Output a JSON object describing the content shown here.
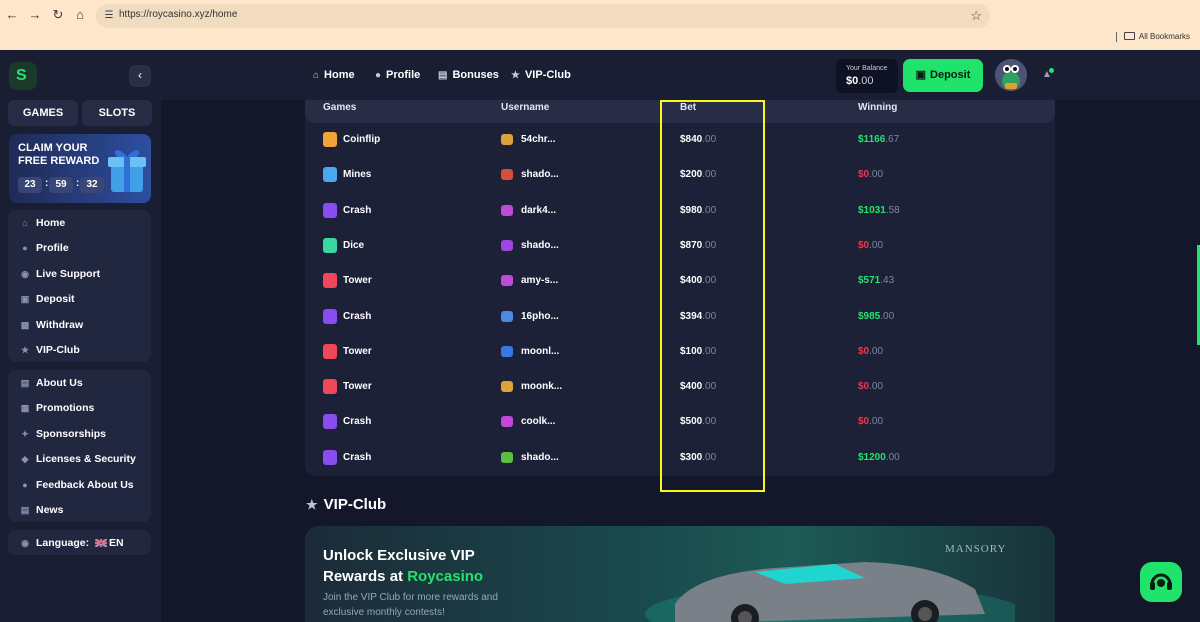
{
  "browser": {
    "url": "https://roycasino.xyz/home",
    "bookmarks_label": "All Bookmarks"
  },
  "sidebar": {
    "tabs": [
      "GAMES",
      "SLOTS"
    ],
    "promo": {
      "title": "CLAIM YOUR FREE REWARD",
      "countdown": [
        "23",
        "59",
        "32"
      ]
    },
    "main_menu": [
      {
        "label": "Home",
        "icon": "home-icon"
      },
      {
        "label": "Profile",
        "icon": "user-icon"
      },
      {
        "label": "Live Support",
        "icon": "headset-icon"
      },
      {
        "label": "Deposit",
        "icon": "wallet-icon"
      },
      {
        "label": "Withdraw",
        "icon": "withdraw-icon"
      },
      {
        "label": "VIP-Club",
        "icon": "star-icon"
      }
    ],
    "info_menu": [
      {
        "label": "About Us",
        "icon": "book-icon"
      },
      {
        "label": "Promotions",
        "icon": "promo-icon"
      },
      {
        "label": "Sponsorships",
        "icon": "sponsor-icon"
      },
      {
        "label": "Licenses & Security",
        "icon": "shield-icon"
      },
      {
        "label": "Feedback About Us",
        "icon": "feedback-icon"
      },
      {
        "label": "News",
        "icon": "news-icon"
      }
    ],
    "language": {
      "label": "Language:",
      "value": "EN"
    }
  },
  "topbar": {
    "nav": [
      "Home",
      "Profile",
      "Bonuses",
      "VIP-Club"
    ],
    "balance_label": "Your Balance",
    "balance_whole": "$0",
    "balance_cents": ".00",
    "deposit_label": "Deposit"
  },
  "table": {
    "headers": [
      "Games",
      "Username",
      "Bet",
      "Winning"
    ],
    "rows": [
      {
        "game": "Coinflip",
        "game_color": "#f2a43a",
        "user": "54chr...",
        "user_color": "#e0a03a",
        "bet": "$840",
        "bet_c": ".00",
        "win": "$1166",
        "win_c": ".67",
        "status": "win"
      },
      {
        "game": "Mines",
        "game_color": "#4aa8f0",
        "user": "shado...",
        "user_color": "#d5503a",
        "bet": "$200",
        "bet_c": ".00",
        "win": "$0",
        "win_c": ".00",
        "status": "loss"
      },
      {
        "game": "Crash",
        "game_color": "#8a4cf0",
        "user": "dark4...",
        "user_color": "#c04ad8",
        "bet": "$980",
        "bet_c": ".00",
        "win": "$1031",
        "win_c": ".58",
        "status": "win"
      },
      {
        "game": "Dice",
        "game_color": "#3ad8a0",
        "user": "shado...",
        "user_color": "#a046e0",
        "bet": "$870",
        "bet_c": ".00",
        "win": "$0",
        "win_c": ".00",
        "status": "loss"
      },
      {
        "game": "Tower",
        "game_color": "#f0485a",
        "user": "amy-s...",
        "user_color": "#c04ad8",
        "bet": "$400",
        "bet_c": ".00",
        "win": "$571",
        "win_c": ".43",
        "status": "win"
      },
      {
        "game": "Crash",
        "game_color": "#8a4cf0",
        "user": "16pho...",
        "user_color": "#4a8ae0",
        "bet": "$394",
        "bet_c": ".00",
        "win": "$985",
        "win_c": ".00",
        "status": "win"
      },
      {
        "game": "Tower",
        "game_color": "#f0485a",
        "user": "moonl...",
        "user_color": "#3a7ae0",
        "bet": "$100",
        "bet_c": ".00",
        "win": "$0",
        "win_c": ".00",
        "status": "loss"
      },
      {
        "game": "Tower",
        "game_color": "#f0485a",
        "user": "moonk...",
        "user_color": "#e0a03a",
        "bet": "$400",
        "bet_c": ".00",
        "win": "$0",
        "win_c": ".00",
        "status": "loss"
      },
      {
        "game": "Crash",
        "game_color": "#8a4cf0",
        "user": "coolk...",
        "user_color": "#c04ad8",
        "bet": "$500",
        "bet_c": ".00",
        "win": "$0",
        "win_c": ".00",
        "status": "loss"
      },
      {
        "game": "Crash",
        "game_color": "#8a4cf0",
        "user": "shado...",
        "user_color": "#5ac040",
        "bet": "$300",
        "bet_c": ".00",
        "win": "$1200",
        "win_c": ".00",
        "status": "win"
      }
    ]
  },
  "vip": {
    "section_title": "VIP-Club",
    "headline_line1": "Unlock Exclusive VIP",
    "headline_line2_prefix": "Rewards at ",
    "headline_brand": "Roycasino",
    "description": "Join the VIP Club for more rewards and exclusive monthly contests!",
    "partner": "MANSORY"
  },
  "colors": {
    "accent_green": "#22e36b",
    "loss_red": "#f0354d",
    "highlight_yellow": "#f7f71c"
  }
}
